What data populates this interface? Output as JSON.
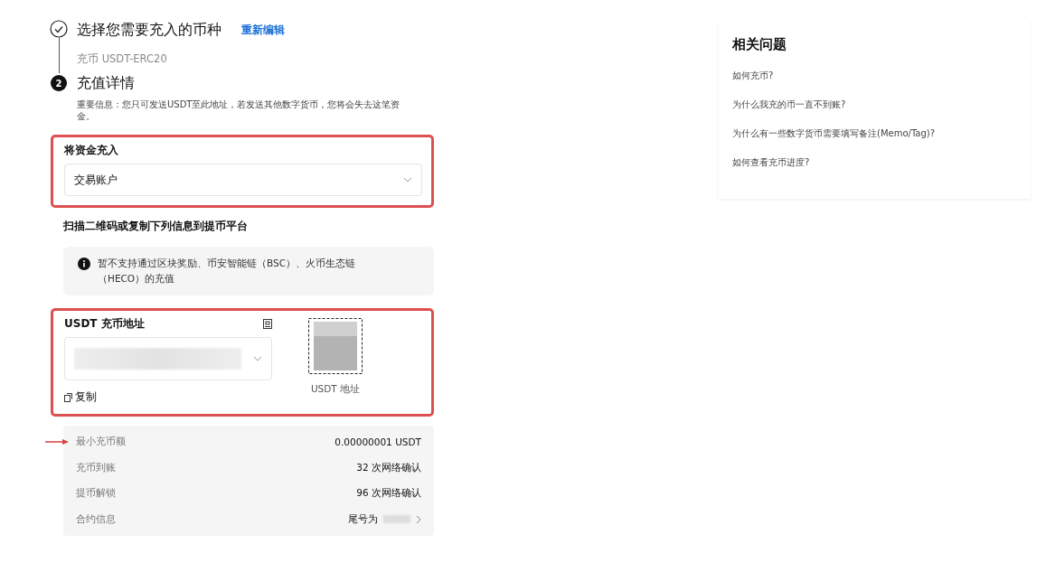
{
  "steps": [
    {
      "kind": "done",
      "title": "选择您需要充入的币种",
      "link": "重新编辑",
      "summary": "充币 USDT-ERC20"
    },
    {
      "kind": "current",
      "number": "2",
      "title": "充值详情",
      "notice": "重要信息：您只可发送USDT至此地址，若发送其他数字货币，您将会失去这笔资金。"
    }
  ],
  "account": {
    "highlighted": true,
    "label": "将资金充入",
    "value": "交易账户"
  },
  "scan_hint": "扫描二维码或复制下列信息到提币平台",
  "alert": "暂不支持通过区块奖励、币安智能链（BSC）、火币生态链（HECO）的充值",
  "address": {
    "highlighted": true,
    "label": "USDT 充币地址",
    "copy": "复制",
    "qr_caption": "USDT 地址"
  },
  "info_rows": [
    {
      "label": "最小充币额",
      "value": "0.00000001 USDT",
      "marked": true,
      "link": false
    },
    {
      "label": "充币到账",
      "value": "32 次网络确认",
      "marked": false,
      "link": false
    },
    {
      "label": "提币解锁",
      "value": "96 次网络确认",
      "marked": false,
      "link": false
    },
    {
      "label": "合约信息",
      "value": "尾号为",
      "marked": false,
      "link": true
    }
  ],
  "faq": {
    "title": "相关问题",
    "items": [
      "如何充币?",
      "为什么我充的币一直不到账?",
      "为什么有一些数字货币需要填写备注(Memo/Tag)?",
      "如何查看充币进度?"
    ]
  }
}
